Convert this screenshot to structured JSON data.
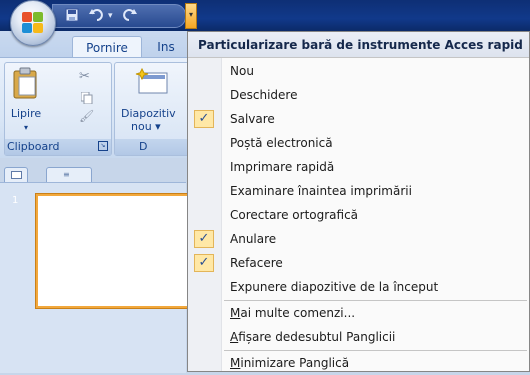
{
  "qat": {
    "save_icon": "save-icon",
    "undo_icon": "undo-icon",
    "redo_icon": "redo-icon",
    "customize_icon": "chevron-down-icon"
  },
  "ribbon": {
    "tabs": [
      {
        "label": "Pornire"
      },
      {
        "label": "Ins"
      }
    ],
    "paste_label": "Lipire",
    "new_slide_label_line1": "Diapozitiv",
    "new_slide_label_line2": "nou ▾",
    "clipboard_group_label": "Clipboard",
    "slides_group_label": "D"
  },
  "slides_panel": {
    "slide_number": "1"
  },
  "menu": {
    "title": "Particularizare bară de instrumente Acces rapid",
    "items": [
      {
        "label": "Nou",
        "checked": false
      },
      {
        "label": "Deschidere",
        "checked": false
      },
      {
        "label": "Salvare",
        "checked": true
      },
      {
        "label": "Poștă electronică",
        "checked": false
      },
      {
        "label": "Imprimare rapidă",
        "checked": false
      },
      {
        "label": "Examinare înaintea imprimării",
        "checked": false
      },
      {
        "label": "Corectare ortografică",
        "checked": false
      },
      {
        "label": "Anulare",
        "checked": true
      },
      {
        "label": "Refacere",
        "checked": true
      },
      {
        "label": "Expunere diapozitive de la început",
        "checked": false
      }
    ],
    "more_commands": {
      "accel": "M",
      "rest": "ai multe comenzi..."
    },
    "show_below": {
      "accel": "A",
      "rest": "fișare dedesubtul Panglicii"
    },
    "minimize": {
      "accel": "M",
      "rest": "inimizare Panglică"
    }
  },
  "colors": {
    "accent": "#15428b",
    "check_bg": "#ffe8a6",
    "titlebar": "#11398a"
  }
}
